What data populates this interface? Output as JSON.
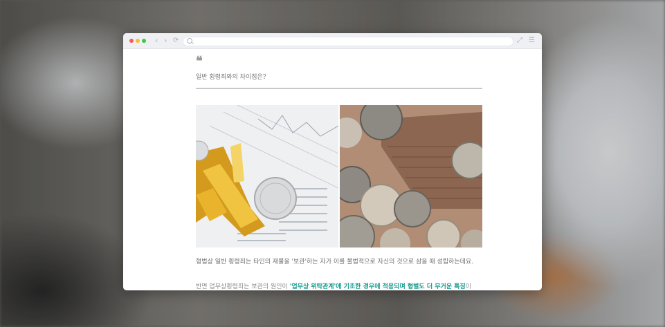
{
  "quote": {
    "mark": "❝",
    "text": "일반 횡령죄와의 차이점은?"
  },
  "images": {
    "left_alt": "금 통화 기호와 동전이 놓인 주식 시세표",
    "right_alt": "지폐 묶음과 동전 더미"
  },
  "paragraphs": {
    "caption": "형법상 일반 횡령죄는 타인의 재물을 '보관'하는 자가 이를 불법적으로 자신의 것으로 삼을 때 성립하는데요.",
    "body_prefix": "반면 업무상횡령죄는 보관의 원인이 ",
    "body_highlight": "'업무상 위탁관계'에 기초한 경우에 적용되며 형벌도 더 무거운 특징",
    "body_suffix": "이"
  },
  "colors": {
    "highlight": "#139a8c",
    "close_dot": "#f35e57",
    "minimize_dot": "#f7be33",
    "zoom_dot": "#3ec64c"
  },
  "icons": [
    "back-icon",
    "forward-icon",
    "reload-icon",
    "search-icon",
    "expand-icon",
    "menu-icon"
  ]
}
